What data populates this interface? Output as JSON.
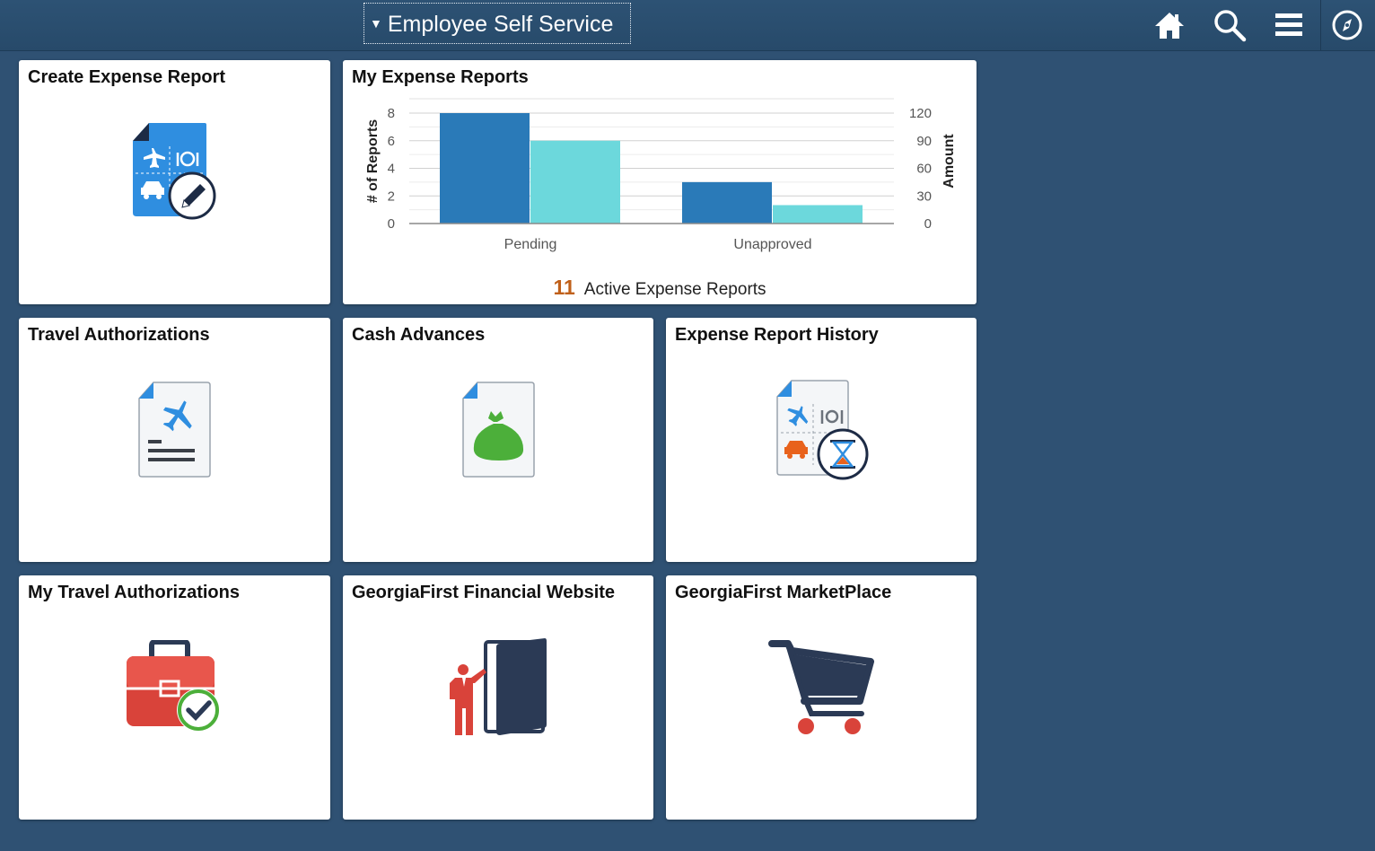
{
  "header": {
    "title": "Employee Self Service",
    "nav_icons": [
      "home-icon",
      "search-icon",
      "menu-icon",
      "navbar-compass-icon"
    ]
  },
  "tiles": {
    "create_expense_report": {
      "title": "Create Expense Report",
      "icon": "expense-report-edit-icon"
    },
    "my_expense_reports": {
      "title": "My Expense Reports"
    },
    "travel_authorizations": {
      "title": "Travel Authorizations",
      "icon": "travel-document-icon"
    },
    "cash_advances": {
      "title": "Cash Advances",
      "icon": "money-bag-document-icon"
    },
    "expense_report_history": {
      "title": "Expense Report History",
      "icon": "expense-history-hourglass-icon"
    },
    "my_travel_authorizations": {
      "title": "My Travel Authorizations",
      "icon": "briefcase-check-icon"
    },
    "georgiafirst_financial_website": {
      "title": "GeorgiaFirst Financial Website",
      "icon": "person-door-icon"
    },
    "georgiafirst_marketplace": {
      "title": "GeorgiaFirst MarketPlace",
      "icon": "shopping-cart-icon"
    }
  },
  "colors": {
    "background": "#2f5173",
    "count_series": "#2a7ab8",
    "amount_series": "#6cd8dc",
    "active_count": "#c0601a"
  },
  "chart_data": {
    "type": "bar",
    "categories": [
      "Pending",
      "Unapproved"
    ],
    "series": [
      {
        "values": [
          8,
          3
        ],
        "axis": "left",
        "color": "#2a7ab8"
      },
      {
        "values": [
          90,
          20
        ],
        "axis": "right",
        "color": "#6cd8dc"
      }
    ],
    "ylabel": "# of Reports",
    "ylabel_right": "Amount",
    "ylim": [
      0,
      8
    ],
    "ylim_right": [
      0,
      120
    ],
    "yticks": [
      "0",
      "2",
      "4",
      "6",
      "8"
    ],
    "yticks_right": [
      "0",
      "30",
      "60",
      "90",
      "120"
    ],
    "grid": true,
    "summary": {
      "count": "11",
      "label": "Active Expense Reports"
    }
  }
}
